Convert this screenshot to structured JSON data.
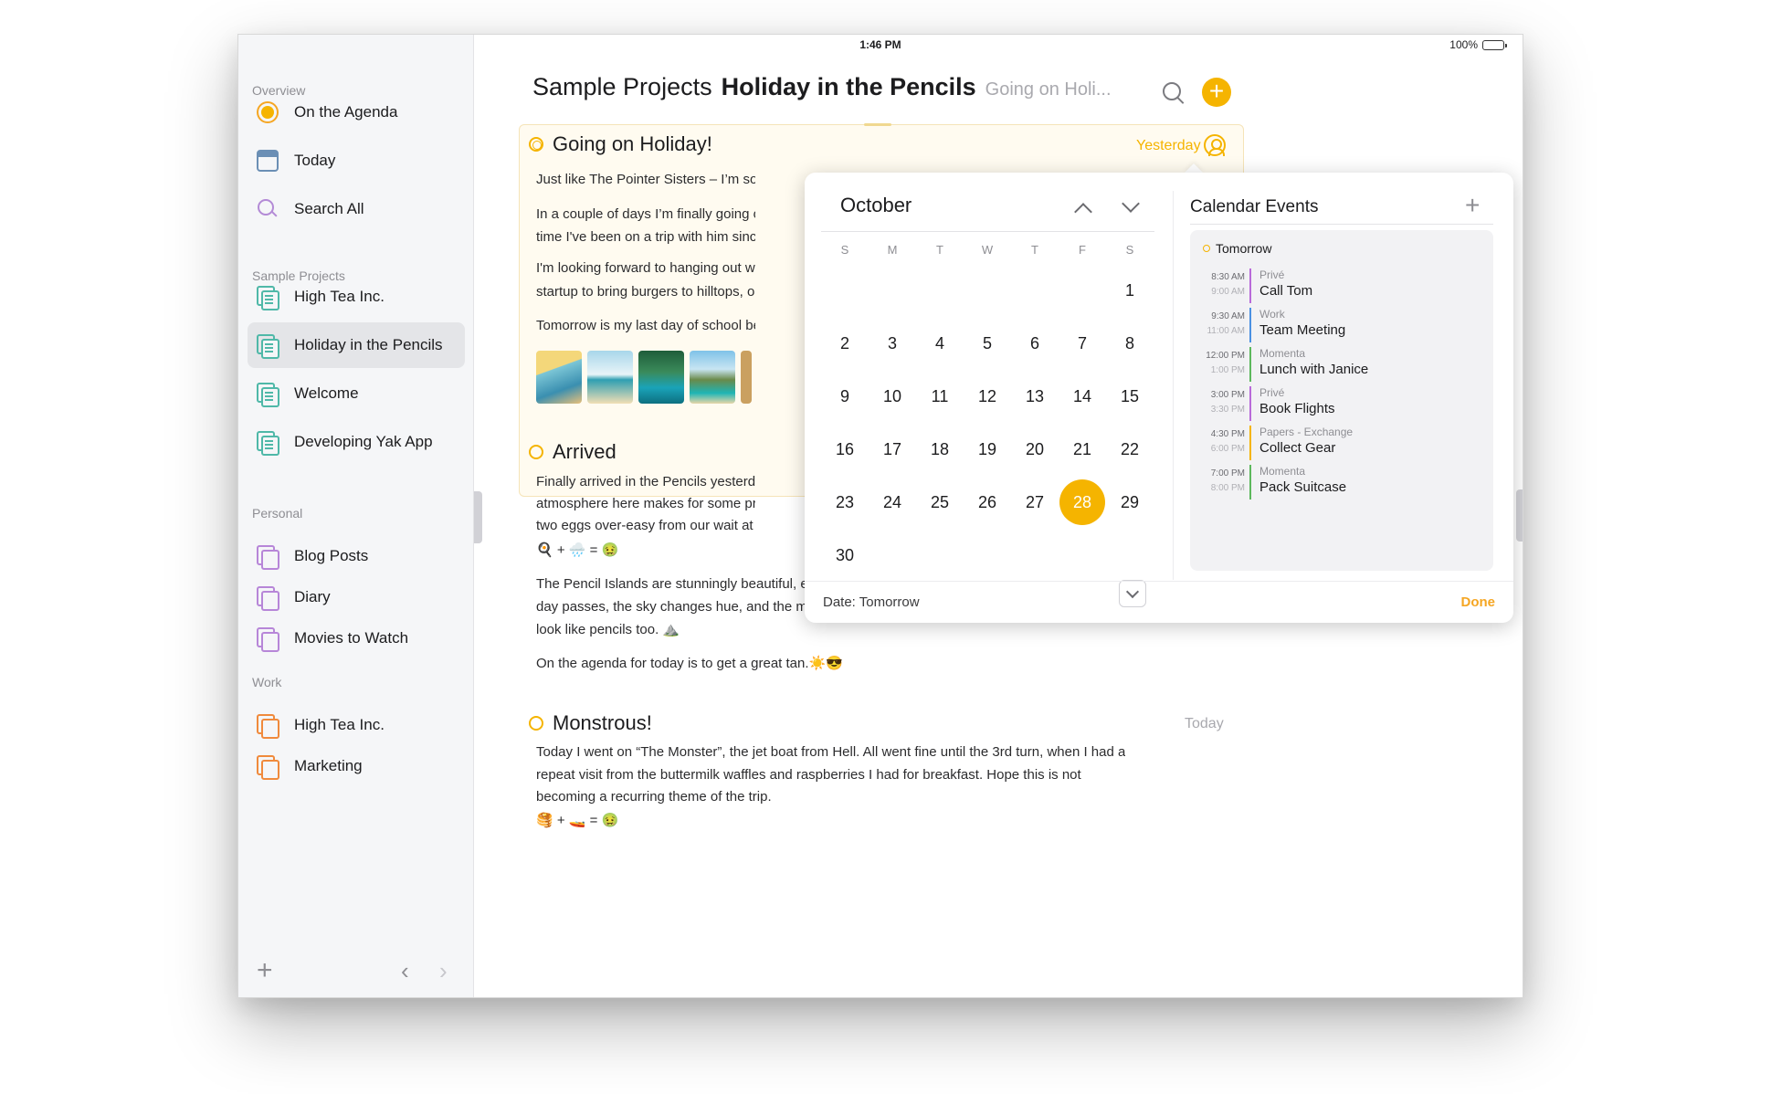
{
  "status": {
    "time": "1:46 PM",
    "battery": "100%"
  },
  "sidebar": {
    "overview_header": "Overview",
    "overview_items": [
      {
        "label": "On the Agenda",
        "icon": "agenda-icon"
      },
      {
        "label": "Today",
        "icon": "calendar-icon"
      },
      {
        "label": "Search All",
        "icon": "search-icon"
      }
    ],
    "sample_header": "Sample Projects",
    "sample_items": [
      {
        "label": "High Tea Inc."
      },
      {
        "label": "Holiday in the Pencils",
        "selected": true
      },
      {
        "label": "Welcome"
      },
      {
        "label": "Developing Yak App"
      }
    ],
    "personal_header": "Personal",
    "personal_items": [
      {
        "label": "Blog Posts"
      },
      {
        "label": "Diary"
      },
      {
        "label": "Movies to Watch"
      }
    ],
    "work_header": "Work",
    "work_items": [
      {
        "label": "High Tea Inc."
      },
      {
        "label": "Marketing"
      }
    ]
  },
  "header": {
    "project": "Sample Projects",
    "document": "Holiday in the Pencils",
    "entry": "Going on Holi..."
  },
  "entries": [
    {
      "title": "Going on Holiday!",
      "date": "Yesterday",
      "paragraphs": [
        "Just like The Pointer Sisters – I’m so exc",
        "In a couple of days I’m finally going on",
        "time I've been on a trip with him since r",
        "I'm looking forward to hanging out with",
        "startup to bring burgers to hilltops, or s",
        "Tomorrow is my last day of school befo"
      ]
    },
    {
      "title": "Arrived",
      "paragraphs": [
        "Finally arrived in the Pencils yesterday e",
        "atmosphere here makes for some pretty",
        "two eggs over-easy from our wait at the",
        "🍳 + 🌧️ = 🤢",
        "The Pencil Islands are stunningly beautiful, even if I have only ventured as far as the pool.👙 As the",
        "day passes, the sky changes hue, and the mountains take on different shades of color. They really do",
        "look like pencils too. ⛰️",
        "On the agenda for today is to get a great tan.☀️😎"
      ]
    },
    {
      "title": "Monstrous!",
      "date": "Today",
      "paragraphs": [
        "Today I went on “The Monster”, the jet boat from Hell. All went fine until the 3rd turn, when I had a",
        "repeat visit from the buttermilk waffles and raspberries I had for breakfast. Hope this is not",
        "becoming a recurring theme of the trip.",
        "🥞 + 🚤 = 🤢"
      ]
    }
  ],
  "calendar": {
    "month": "October",
    "weekdays": [
      "S",
      "M",
      "T",
      "W",
      "T",
      "F",
      "S"
    ],
    "leading_blanks": 6,
    "days": 30,
    "selected_day": 28,
    "footer_label": "Date: Tomorrow",
    "done_label": "Done"
  },
  "events": {
    "title": "Calendar Events",
    "day_label": "Tomorrow",
    "items": [
      {
        "start": "8:30 AM",
        "end": "9:00 AM",
        "calendar": "Privé",
        "name": "Call Tom",
        "color": "#b96ad9"
      },
      {
        "start": "9:30 AM",
        "end": "11:00 AM",
        "calendar": "Work",
        "name": "Team Meeting",
        "color": "#4a90e2"
      },
      {
        "start": "12:00 PM",
        "end": "1:00 PM",
        "calendar": "Momenta",
        "name": "Lunch with Janice",
        "color": "#5cb85c"
      },
      {
        "start": "3:00 PM",
        "end": "3:30 PM",
        "calendar": "Privé",
        "name": "Book Flights",
        "color": "#b96ad9"
      },
      {
        "start": "4:30 PM",
        "end": "6:00 PM",
        "calendar": "Papers - Exchange",
        "name": "Collect Gear",
        "color": "#f5b400"
      },
      {
        "start": "7:00 PM",
        "end": "8:00 PM",
        "calendar": "Momenta",
        "name": "Pack Suitcase",
        "color": "#5cb85c"
      }
    ]
  },
  "colors": {
    "accent": "#f5b400",
    "sidebar_bg": "#f5f6f8",
    "card_bg": "#fffbf0"
  }
}
